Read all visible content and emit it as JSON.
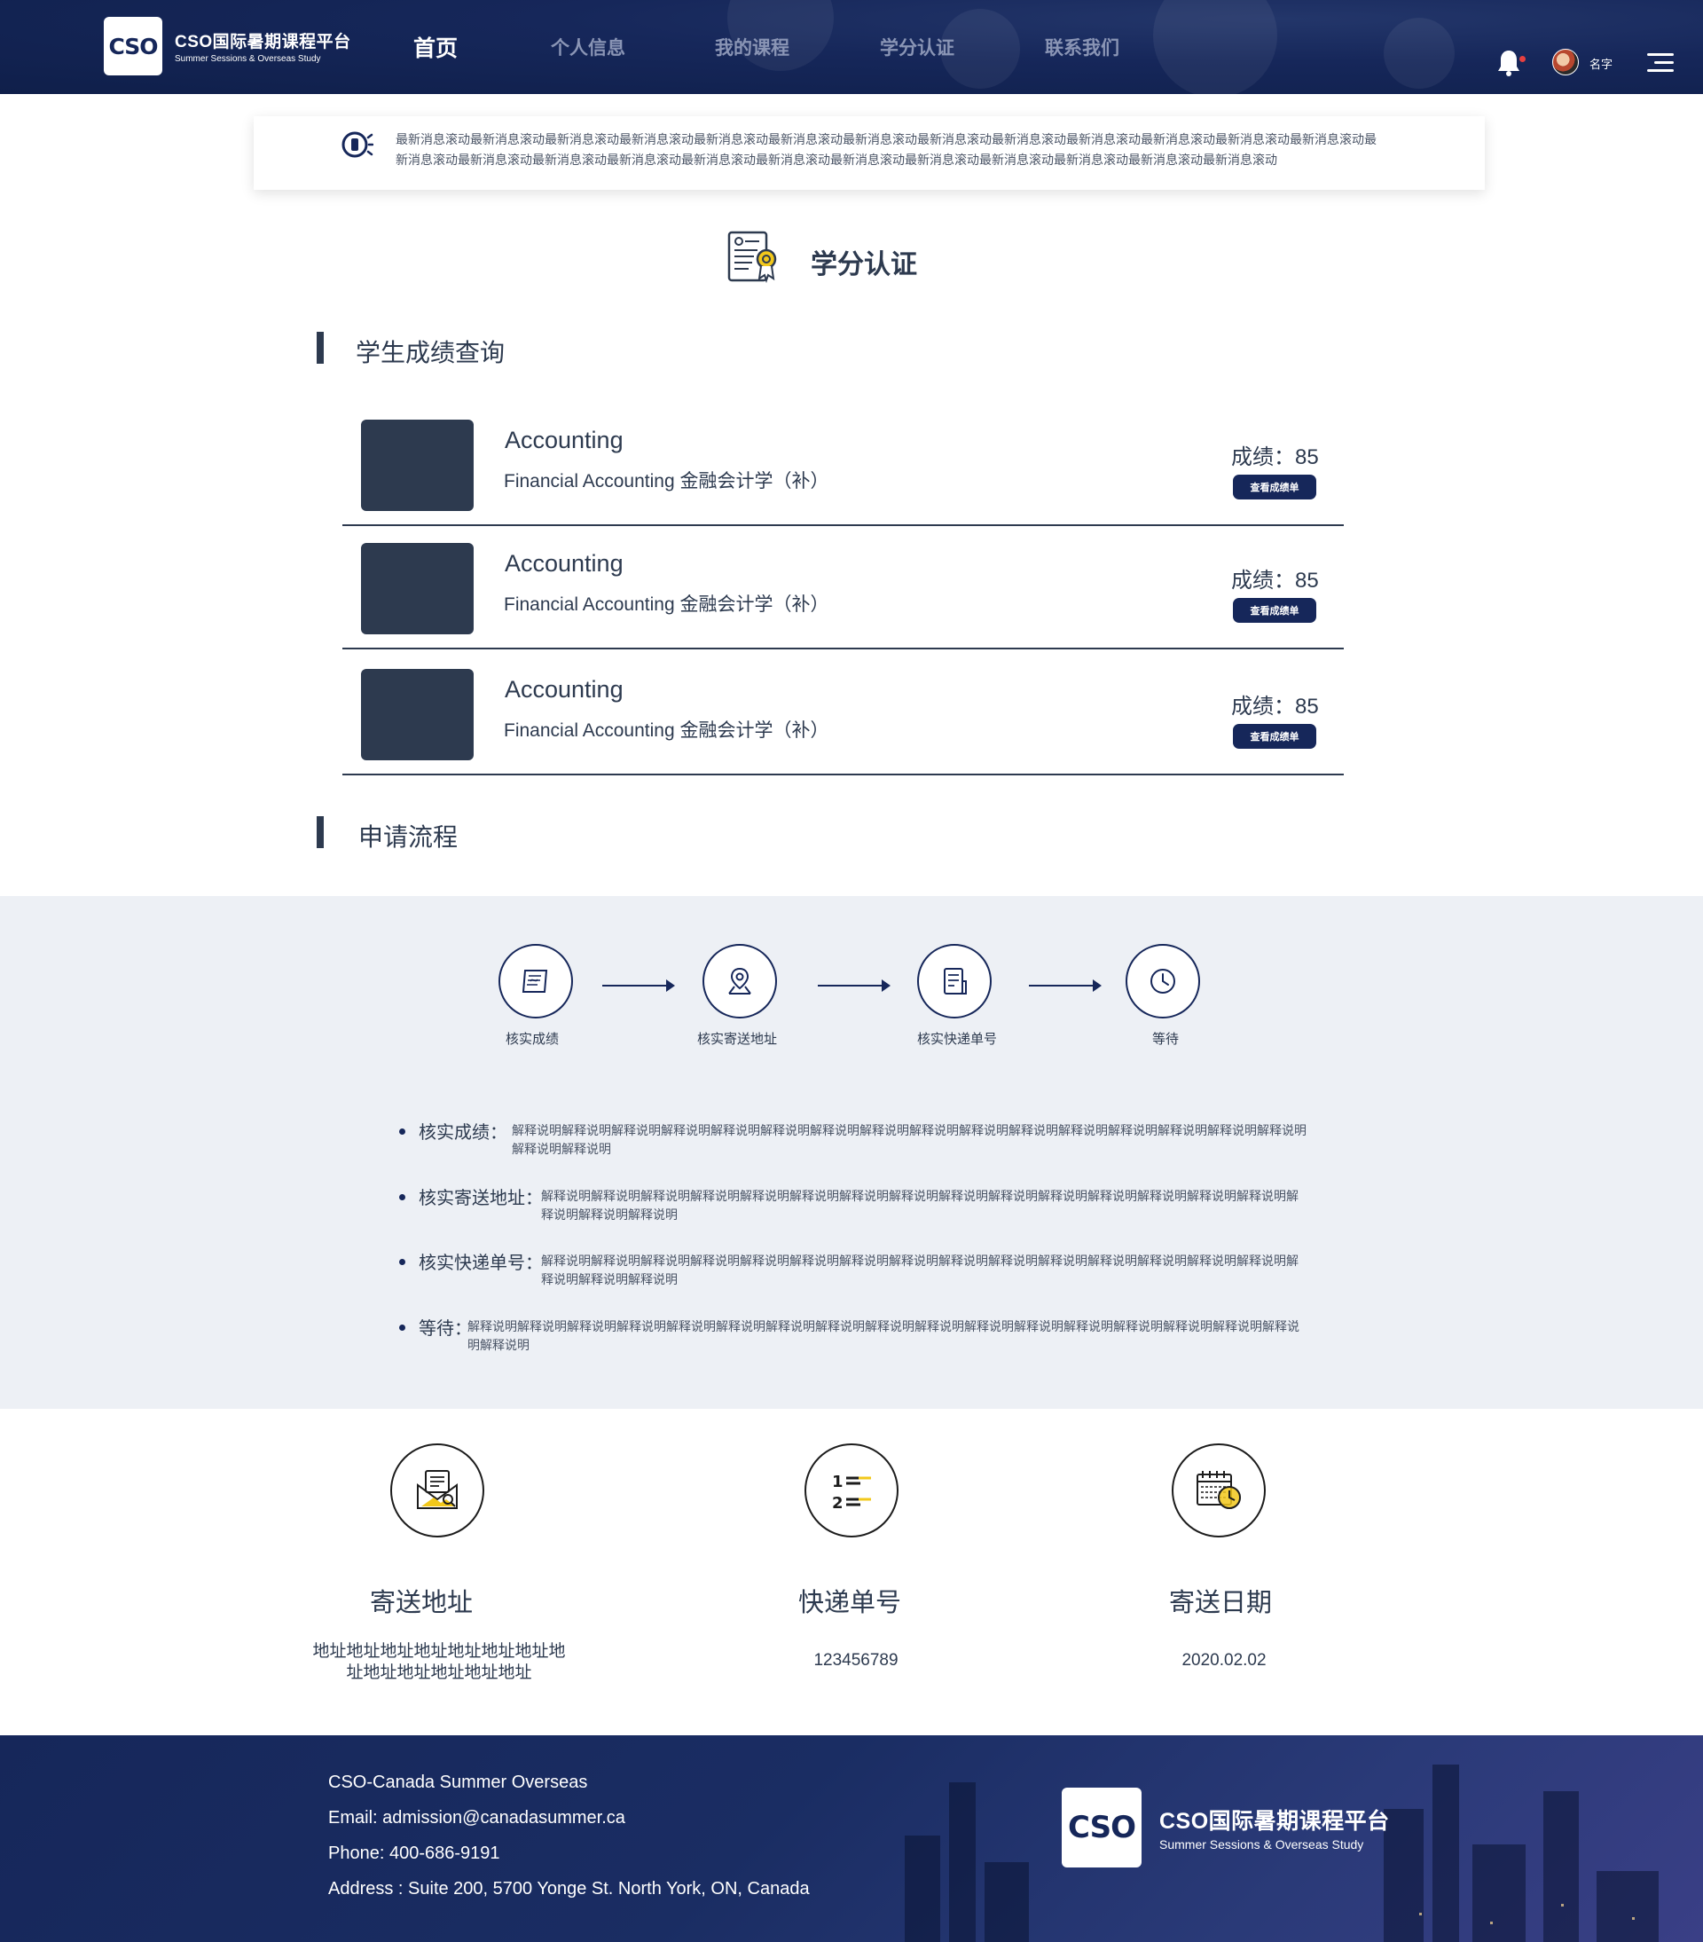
{
  "header": {
    "logo_mark": "CSO",
    "logo_title": "CSO国际暑期课程平台",
    "logo_subtitle": "Summer Sessions & Overseas Study",
    "nav": [
      "首页",
      "个人信息",
      "我的课程",
      "学分认证",
      "联系我们"
    ],
    "active_nav": "首页",
    "user_name": "名字",
    "icons": [
      "bell-icon",
      "avatar",
      "menu-icon"
    ]
  },
  "notice": {
    "icon": "speaker-icon",
    "text": "最新消息滚动最新消息滚动最新消息滚动最新消息滚动最新消息滚动最新消息滚动最新消息滚动最新消息滚动最新消息滚动最新消息滚动最新消息滚动最新消息滚动最新消息滚动最新消息滚动最新消息滚动最新消息滚动最新消息滚动最新消息滚动最新消息滚动最新消息滚动最新消息滚动最新消息滚动最新消息滚动最新消息滚动最新消息滚动"
  },
  "page": {
    "title": "学分认证",
    "title_icon": "certificate-icon"
  },
  "scores_section": {
    "heading": "学生成绩查询",
    "items": [
      {
        "title": "Accounting",
        "subtitle": "Financial Accounting 金融会计学（补）",
        "score": "成绩：85",
        "button": "查看成绩单"
      },
      {
        "title": "Accounting",
        "subtitle": "Financial Accounting 金融会计学（补）",
        "score": "成绩：85",
        "button": "查看成绩单"
      },
      {
        "title": "Accounting",
        "subtitle": "Financial Accounting 金融会计学（补）",
        "score": "成绩：85",
        "button": "查看成绩单"
      }
    ]
  },
  "process_section": {
    "heading": "申请流程",
    "steps": [
      {
        "label": "核实成绩",
        "icon": "transcript-icon"
      },
      {
        "label": "核实寄送地址",
        "icon": "map-pin-icon"
      },
      {
        "label": "核实快递单号",
        "icon": "document-icon"
      },
      {
        "label": "等待",
        "icon": "clock-icon"
      }
    ],
    "descriptions": [
      {
        "term": "核实成绩：",
        "text": "解释说明解释说明解释说明解释说明解释说明解释说明解释说明解释说明解释说明解释说明解释说明解释说明解释说明解释说明解释说明解释说明解释说明解释说明"
      },
      {
        "term": "核实寄送地址：",
        "text": "解释说明解释说明解释说明解释说明解释说明解释说明解释说明解释说明解释说明解释说明解释说明解释说明解释说明解释说明解释说明解释说明解释说明解释说明"
      },
      {
        "term": "核实快递单号：",
        "text": "解释说明解释说明解释说明解释说明解释说明解释说明解释说明解释说明解释说明解释说明解释说明解释说明解释说明解释说明解释说明解释说明解释说明解释说明"
      },
      {
        "term": "等待：",
        "text": "解释说明解释说明解释说明解释说明解释说明解释说明解释说明解释说明解释说明解释说明解释说明解释说明解释说明解释说明解释说明解释说明解释说明解释说明"
      }
    ]
  },
  "delivery": [
    {
      "title": "寄送地址",
      "value": "地址地址地址地址地址地址地址地址地址地址地址地址地址",
      "icon": "envelope-icon"
    },
    {
      "title": "快递单号",
      "value": "123456789",
      "icon": "numbered-list-icon"
    },
    {
      "title": "寄送日期",
      "value": "2020.02.02",
      "icon": "calendar-icon"
    }
  ],
  "footer": {
    "lines": [
      "CSO-Canada Summer Overseas",
      "Email: admission@canadasummer.ca",
      "Phone: 400-686-9191",
      "Address : Suite 200, 5700 Yonge St. North York, ON, Canada"
    ],
    "logo_mark": "CSO",
    "logo_title": "CSO国际暑期课程平台",
    "logo_subtitle": "Summer Sessions & Overseas Study"
  },
  "colors": {
    "navy": "#16275a",
    "slate": "#2d3a4f",
    "accent_yellow": "#f2c81b",
    "process_bg": "#edf0f5"
  }
}
